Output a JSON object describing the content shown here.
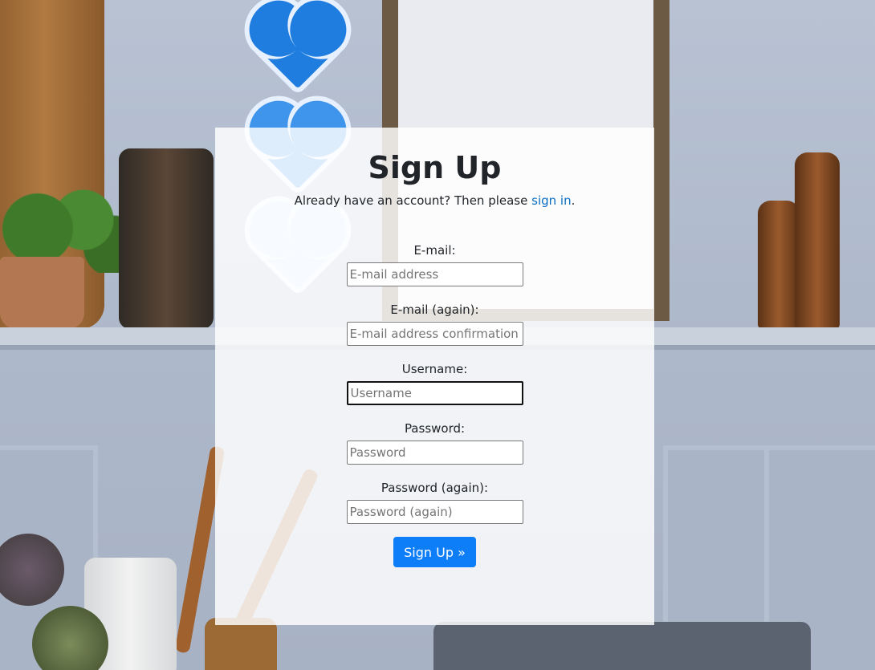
{
  "page": {
    "title": "Sign Up",
    "subtitle_text": "Already have an account? Then please ",
    "subtitle_link": "sign in",
    "subtitle_end": "."
  },
  "form": {
    "email": {
      "label": "E-mail:",
      "placeholder": "E-mail address"
    },
    "email2": {
      "label": "E-mail (again):",
      "placeholder": "E-mail address confirmation"
    },
    "username": {
      "label": "Username:",
      "placeholder": "Username"
    },
    "password": {
      "label": "Password:",
      "placeholder": "Password"
    },
    "password2": {
      "label": "Password (again):",
      "placeholder": "Password (again)"
    },
    "submit_label": "Sign Up »"
  },
  "colors": {
    "accent": "#0d7ef8",
    "link": "#0a6fc4"
  }
}
